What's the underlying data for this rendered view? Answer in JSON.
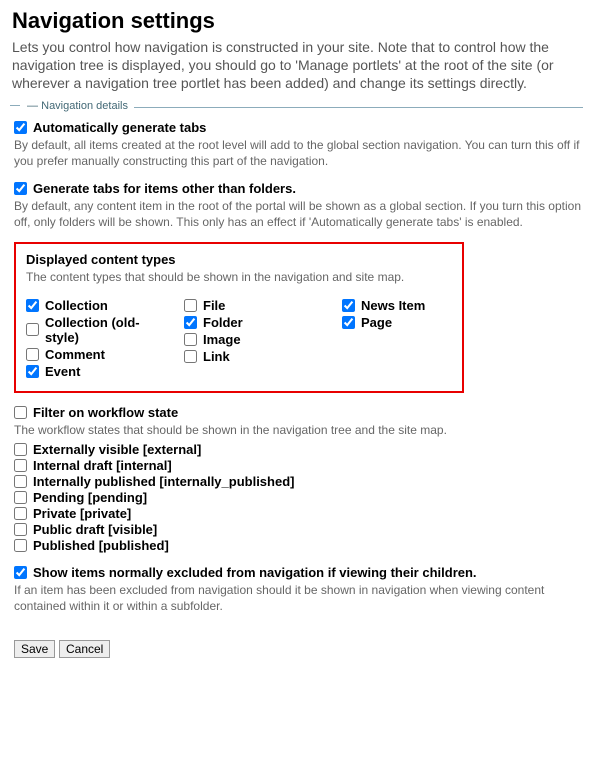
{
  "title": "Navigation settings",
  "description": "Lets you control how navigation is constructed in your site. Note that to control how the navigation tree is displayed, you should go to 'Manage portlets' at the root of the site (or wherever a navigation tree portlet has been added) and change its settings directly.",
  "fieldset_legend": "Navigation details",
  "auto_tabs": {
    "label": "Automatically generate tabs",
    "checked": true,
    "help": "By default, all items created at the root level will add to the global section navigation. You can turn this off if you prefer manually constructing this part of the navigation."
  },
  "nonfolder_tabs": {
    "label": "Generate tabs for items other than folders.",
    "checked": true,
    "help": "By default, any content item in the root of the portal will be shown as a global section. If you turn this option off, only folders will be shown. This only has an effect if 'Automatically generate tabs' is enabled."
  },
  "displayed_types": {
    "heading": "Displayed content types",
    "help": "The content types that should be shown in the navigation and site map.",
    "columns": [
      [
        {
          "label": "Collection",
          "checked": true
        },
        {
          "label": "Collection (old-style)",
          "checked": false
        },
        {
          "label": "Comment",
          "checked": false
        },
        {
          "label": "Event",
          "checked": true
        }
      ],
      [
        {
          "label": "File",
          "checked": false
        },
        {
          "label": "Folder",
          "checked": true
        },
        {
          "label": "Image",
          "checked": false
        },
        {
          "label": "Link",
          "checked": false
        }
      ],
      [
        {
          "label": "News Item",
          "checked": true
        },
        {
          "label": "Page",
          "checked": true
        }
      ]
    ]
  },
  "filter_state": {
    "label": "Filter on workflow state",
    "checked": false,
    "help": "The workflow states that should be shown in the navigation tree and the site map.",
    "states": [
      {
        "label": "Externally visible [external]",
        "checked": false
      },
      {
        "label": "Internal draft [internal]",
        "checked": false
      },
      {
        "label": "Internally published [internally_published]",
        "checked": false
      },
      {
        "label": "Pending [pending]",
        "checked": false
      },
      {
        "label": "Private [private]",
        "checked": false
      },
      {
        "label": "Public draft [visible]",
        "checked": false
      },
      {
        "label": "Published [published]",
        "checked": false
      }
    ]
  },
  "show_excluded": {
    "label": "Show items normally excluded from navigation if viewing their children.",
    "checked": true,
    "help": "If an item has been excluded from navigation should it be shown in navigation when viewing content contained within it or within a subfolder."
  },
  "buttons": {
    "save": "Save",
    "cancel": "Cancel"
  }
}
